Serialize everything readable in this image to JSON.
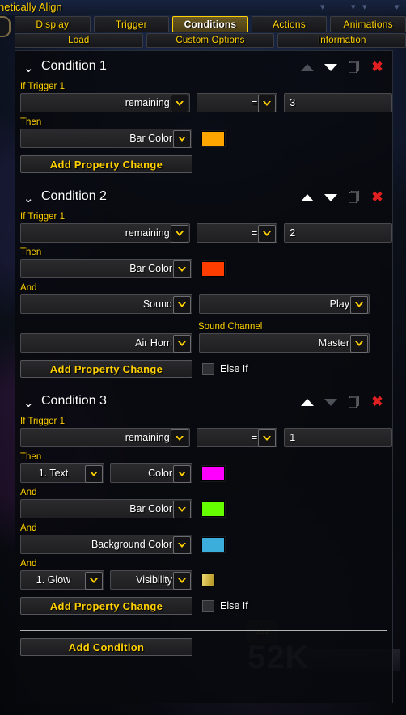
{
  "window": {
    "title": "netically Align",
    "watermark_number": "52K",
    "watermark_zzz": "zzz"
  },
  "tabs_row1": [
    {
      "label": "Display",
      "selected": false
    },
    {
      "label": "Trigger",
      "selected": false
    },
    {
      "label": "Conditions",
      "selected": true
    },
    {
      "label": "Actions",
      "selected": false
    },
    {
      "label": "Animations",
      "selected": false
    }
  ],
  "tabs_row2": [
    {
      "label": "Load",
      "selected": false
    },
    {
      "label": "Custom Options",
      "selected": false
    },
    {
      "label": "Information",
      "selected": false
    }
  ],
  "labels": {
    "if_trigger": "If Trigger 1",
    "then": "Then",
    "and": "And",
    "sound_channel": "Sound Channel",
    "else_if": "Else If"
  },
  "buttons": {
    "add_property_change": "Add Property Change",
    "add_condition": "Add Condition"
  },
  "icons": {
    "collapse": "chevron-down-icon",
    "move_up": "arrow-up-icon",
    "move_down": "arrow-down-icon",
    "duplicate": "duplicate-icon",
    "delete": "close-icon"
  },
  "colors": {
    "accent_gold": "#ffd100",
    "bar_color_1": "#ffa500",
    "bar_color_2": "#ff3d00",
    "text_color_3": "#ff00ff",
    "bar_color_3": "#66ff00",
    "background_color_3": "#3baedc",
    "glow_visibility": "#e8c226"
  },
  "conditions": [
    {
      "title": "Condition 1",
      "up_enabled": false,
      "down_enabled": true,
      "trigger_property": "remaining",
      "operator": "=",
      "value": "3",
      "then_rows": [
        {
          "kind": "color",
          "property": "Bar Color",
          "swatch": "#ffa500"
        }
      ],
      "has_else_if": false,
      "else_if_checked": false
    },
    {
      "title": "Condition 2",
      "up_enabled": true,
      "down_enabled": true,
      "trigger_property": "remaining",
      "operator": "=",
      "value": "2",
      "then_rows": [
        {
          "kind": "color",
          "property": "Bar Color",
          "swatch": "#ff3d00"
        },
        {
          "kind": "sound",
          "property": "Sound",
          "action": "Play",
          "sound_name": "Air Horn",
          "channel_label": "Sound Channel",
          "channel": "Master"
        }
      ],
      "has_else_if": true,
      "else_if_checked": false
    },
    {
      "title": "Condition 3",
      "up_enabled": true,
      "down_enabled": false,
      "trigger_property": "remaining",
      "operator": "=",
      "value": "1",
      "then_rows": [
        {
          "kind": "sub_color",
          "sub_target": "1. Text",
          "property": "Color",
          "swatch": "#ff00ff"
        },
        {
          "kind": "color",
          "property": "Bar Color",
          "swatch": "#66ff00"
        },
        {
          "kind": "color",
          "property": "Background Color",
          "swatch": "#3baedc"
        },
        {
          "kind": "sub_check",
          "sub_target": "1. Glow",
          "property": "Visibility",
          "swatch": "#e8c226"
        }
      ],
      "has_else_if": true,
      "else_if_checked": false
    }
  ]
}
